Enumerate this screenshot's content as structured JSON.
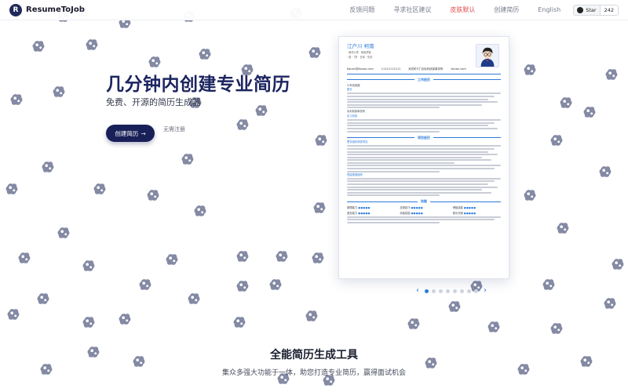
{
  "brand": {
    "name": "ResumeToJob",
    "logo_letter": "R"
  },
  "nav": {
    "links": [
      "反馈问题",
      "寻求社区建议",
      "皮肤默认",
      "创建简历",
      "English"
    ],
    "active_index": 2,
    "star": {
      "label": "Star",
      "count": "242"
    }
  },
  "hero": {
    "title": "几分钟内创建专业简历",
    "subtitle": "免费、开源的简历生成器",
    "cta_label": "创建简历",
    "cta_arrow": "→",
    "cta_note": "无需注册"
  },
  "resume": {
    "name": "江户川 柯南",
    "meta": [
      "· 帝丹小学 · 侦探学徒",
      "· 男 · 7岁 · 日本 · 东京"
    ],
    "contact": [
      "Konan@Konan.com",
      "11111111111",
      "米花町5丁目毛利侦探事务所",
      "konan.com"
    ],
    "sections": [
      {
        "title": "工作经历",
        "entries": [
          {
            "left": "少年侦探团",
            "right": "",
            "sub": "团长",
            "lines": 6
          },
          {
            "left": "毛利侦探事务所",
            "right": "",
            "sub": "实习侦探",
            "lines": 5
          }
        ]
      },
      {
        "title": "项目经历",
        "entries": [
          {
            "left": "黑衣组织调查项目",
            "right": "",
            "sub": "",
            "lines": 10
          },
          {
            "left": "怪盗基德追踪",
            "right": "",
            "sub": "",
            "lines": 7
          }
        ]
      }
    ],
    "skills_title": "技能",
    "skills": [
      {
        "name": "推理能力",
        "dots": "●●●●●"
      },
      {
        "name": "足球技巧",
        "dots": "●●●●●"
      },
      {
        "name": "滑板技能",
        "dots": "●●●●●"
      },
      {
        "name": "语言能力",
        "dots": "●●●●●"
      },
      {
        "name": "伪装技能",
        "dots": "●●●●●"
      },
      {
        "name": "音乐天赋",
        "dots": "●●●●●"
      }
    ],
    "footer_lines": 3
  },
  "carousel": {
    "prev": "‹",
    "next": "›",
    "dots": 8,
    "active": 0
  },
  "features": {
    "title": "全能简历生成工具",
    "subtitle": "集众多强大功能于一体，助您打造专业简历，赢得面试机会"
  },
  "colors": {
    "accent": "#2b7bdc",
    "brand_dark": "#182057",
    "active_nav": "#e24b4b",
    "blob": "#1f2a5a"
  }
}
